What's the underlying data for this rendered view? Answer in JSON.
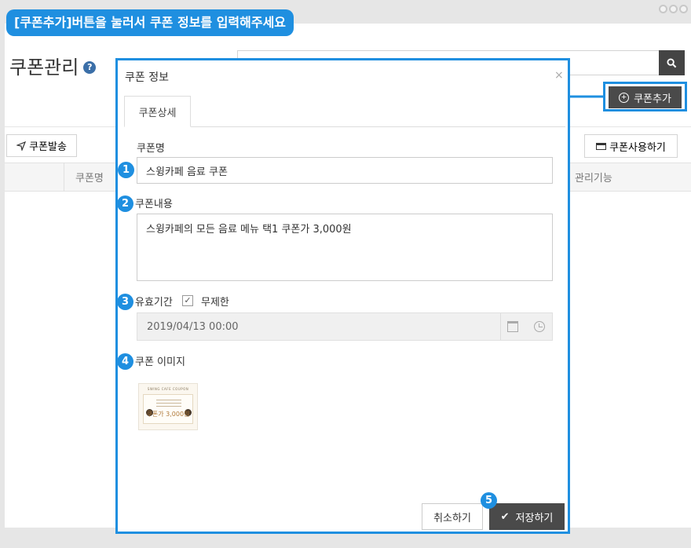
{
  "banner": "[쿠폰추가]버튼을 눌러서 쿠폰 정보를 입력해주세요",
  "page": {
    "title": "쿠폰관리",
    "help_icon": "question-circle-icon"
  },
  "toolbar": {
    "add_coupon": "쿠폰추가",
    "send_coupon": "쿠폰발송",
    "use_coupon": "쿠폰사용하기"
  },
  "table": {
    "headers": [
      "쿠폰명",
      "관리기능"
    ]
  },
  "modal": {
    "title": "쿠폰 정보",
    "close": "×",
    "tab": "쿠폰상세",
    "coupon_name_label": "쿠폰명",
    "coupon_name_value": "스윙카페 음료 쿠폰",
    "coupon_content_label": "쿠폰내용",
    "coupon_content_value": "스윙카페의 모든 음료 메뉴 택1 쿠폰가  3,000원",
    "validity_label": "유효기간",
    "unlimited_label": "무제한",
    "unlimited_checked": true,
    "date_value": "2019/04/13 00:00",
    "image_label": "쿠폰 이미지",
    "image_header": "SWING CAFE COUPON",
    "image_price": "쿠폰가 3,000원",
    "cancel": "취소하기",
    "save": "저장하기"
  },
  "badges": [
    "1",
    "2",
    "3",
    "4",
    "5"
  ],
  "colors": {
    "accent": "#1f8fe0",
    "dark_button": "#4a4a4a"
  }
}
